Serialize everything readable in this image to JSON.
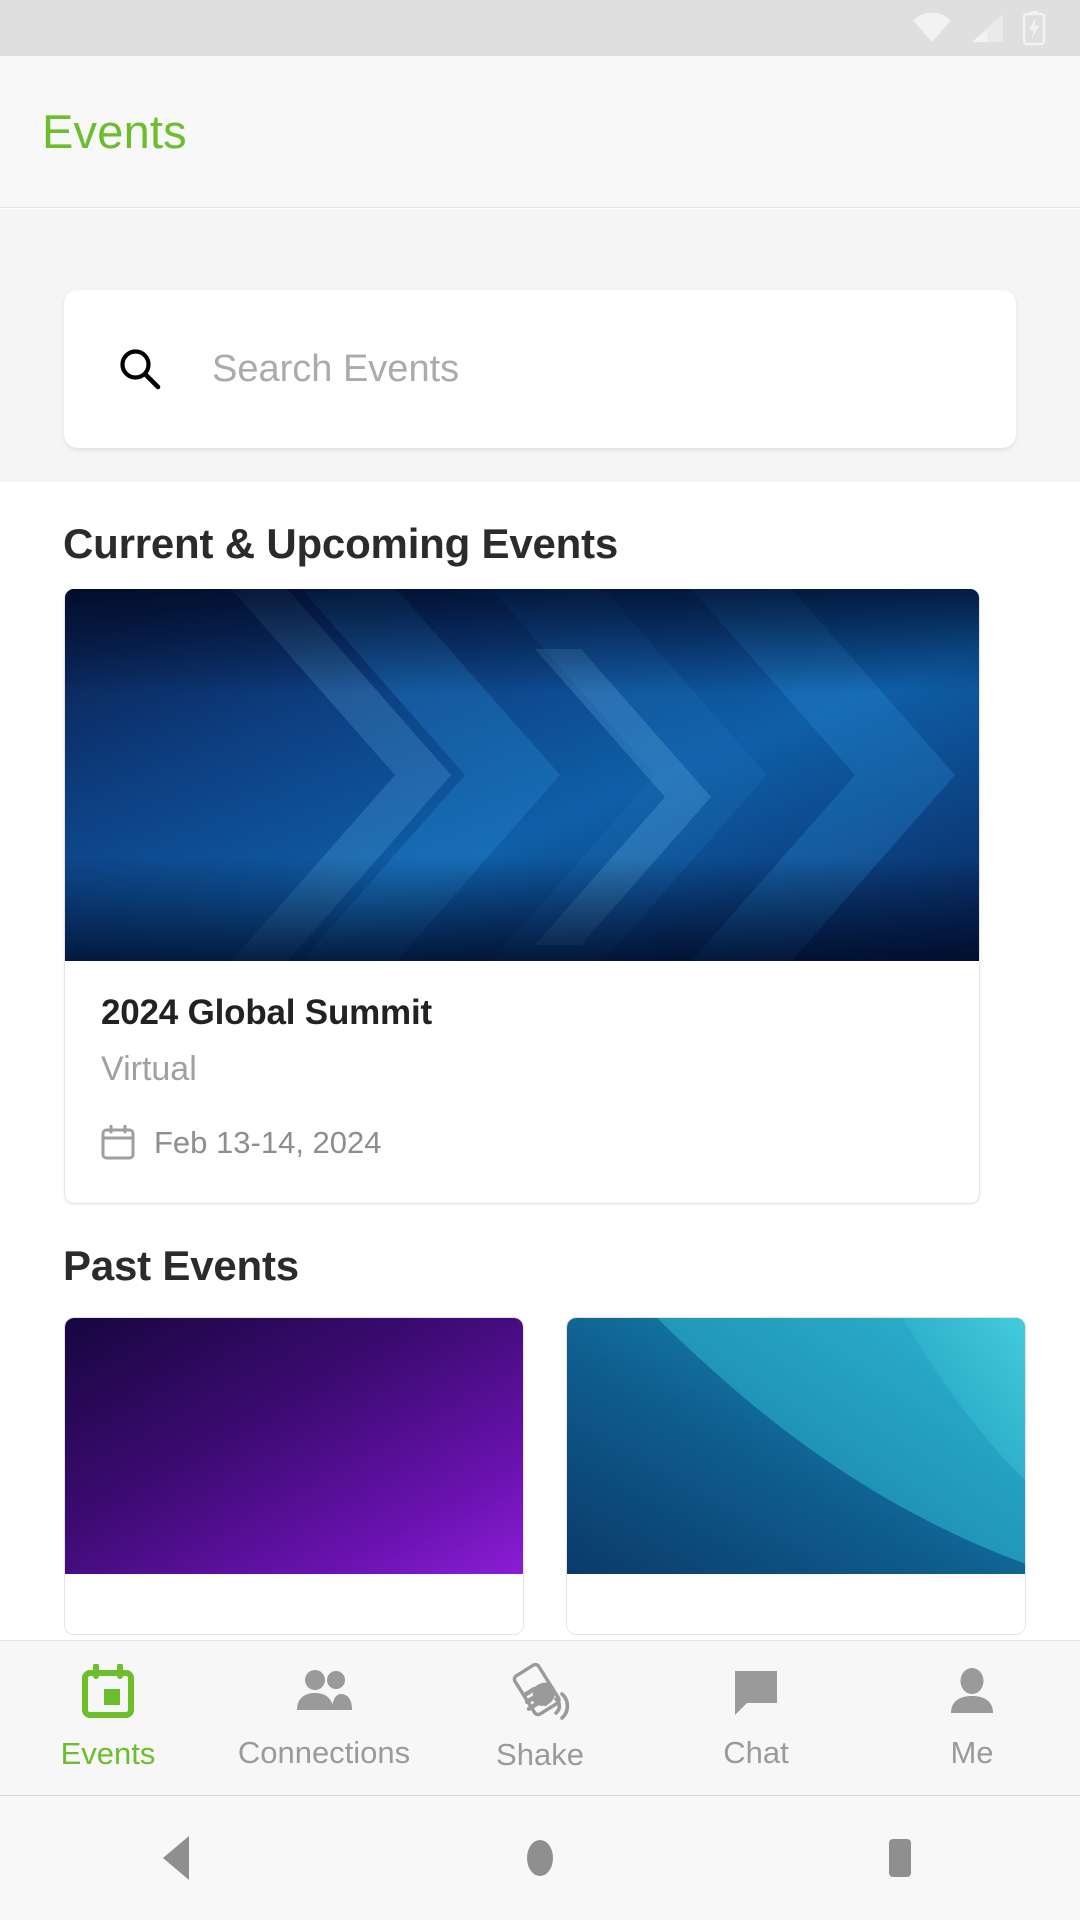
{
  "statusbar": {
    "icons": [
      "wifi-icon",
      "cellular-signal-icon",
      "battery-charging-icon"
    ]
  },
  "appbar": {
    "title": "Events",
    "title_color": "#6cbe2c"
  },
  "search": {
    "icon": "search-icon",
    "placeholder": "Search Events",
    "value": ""
  },
  "sections": {
    "current": {
      "heading": "Current & Upcoming Events",
      "events": [
        {
          "title": "2024 Global Summit",
          "location": "Virtual",
          "date": "Feb 13-14, 2024",
          "date_icon": "calendar-icon",
          "banner": "blue-chevron-gradient"
        }
      ]
    },
    "past": {
      "heading": "Past Events",
      "events": [
        {
          "banner": "purple-gradient"
        },
        {
          "banner": "teal-swoosh-gradient"
        }
      ]
    }
  },
  "bottomnav": {
    "items": [
      {
        "label": "Events",
        "icon": "calendar-event-icon",
        "active": true
      },
      {
        "label": "Connections",
        "icon": "people-icon",
        "active": false
      },
      {
        "label": "Shake",
        "icon": "shake-phone-icon",
        "active": false
      },
      {
        "label": "Chat",
        "icon": "chat-bubble-icon",
        "active": false
      },
      {
        "label": "Me",
        "icon": "person-icon",
        "active": false
      }
    ],
    "active_color": "#6cbe2c",
    "inactive_color": "#9a9a9a"
  },
  "androidnav": {
    "buttons": [
      {
        "icon": "back-triangle-icon"
      },
      {
        "icon": "home-circle-icon"
      },
      {
        "icon": "recents-square-icon"
      }
    ]
  }
}
